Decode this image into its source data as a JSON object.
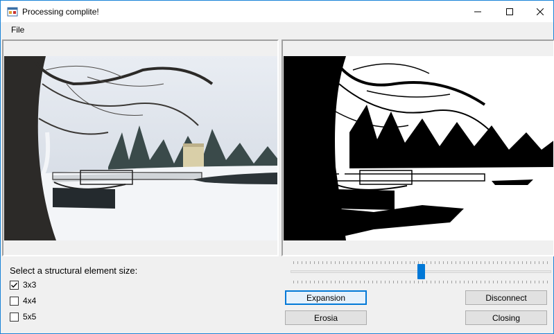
{
  "window": {
    "title": "Processing complite!",
    "icon": "app-window-icon",
    "controls": [
      "minimize-icon",
      "maximize-icon",
      "close-icon"
    ]
  },
  "menu": {
    "file": "File"
  },
  "images": {
    "original": "winter-park-photo",
    "processed": "binary-threshold-photo"
  },
  "structural_element": {
    "label": "Select a structural element size:",
    "options": [
      {
        "label": "3x3",
        "checked": true
      },
      {
        "label": "4x4",
        "checked": false
      },
      {
        "label": "5x5",
        "checked": false
      }
    ]
  },
  "slider": {
    "level": 0.5
  },
  "buttons": {
    "expansion": "Expansion",
    "erosia": "Erosia",
    "disconnect": "Disconnect",
    "closing": "Closing"
  },
  "colors": {
    "accent": "#0078d7",
    "window_border": "#1883d7"
  }
}
